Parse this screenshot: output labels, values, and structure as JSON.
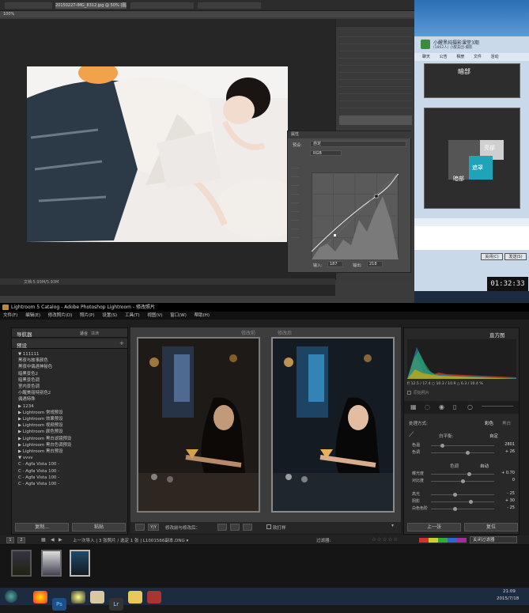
{
  "ps": {
    "tab1": "20150227-IMG_8312.jpg @ 50% (图层 1, RGB/8)",
    "zoom": "50%",
    "zoom_value": "100%",
    "status": "文档:5.93M/5.93M"
  },
  "curves": {
    "panel_tab": "属性",
    "preset": "自定",
    "channel": "RGB",
    "input_label": "输入:",
    "input_value": "187",
    "output_label": "输出:",
    "output_value": "218"
  },
  "chat": {
    "group_title": "小醒黑纯摄影课堂3期",
    "group_sub": "(1862人) 小醒美团-摄影",
    "tabs": [
      "聊天",
      "公告",
      "相册",
      "文件",
      "活动",
      "设置"
    ],
    "panel_labels": [
      "亮部",
      "遮罩",
      "暗部"
    ],
    "btn_close": "关闭(C)",
    "btn_send": "发送(S)",
    "time": "01:32:33"
  },
  "lr": {
    "title": "Lightroom 5 Catalog - Adobe Photoshop Lightroom - 修改照片",
    "menus": [
      "文件(F)",
      "编辑(E)",
      "修改照片(D)",
      "照片(P)",
      "设置(S)",
      "工具(T)",
      "视图(V)",
      "窗口(W)",
      "帮助(H)"
    ],
    "navigator": "导航器",
    "nav_fit": "适合",
    "nav_fill": "填满",
    "presets_title": "预设",
    "preset_tree": [
      "▼ 111111",
      "    黑夜与故事颜色",
      "    黑夜中偶遇神秘色",
      "    暗黑景色2",
      "    暗黑景色调",
      "    室内景色调",
      "    小醒美丽特别色2",
      "    偶遇特殊",
      "▶ 1234",
      "▶ Lightroom 常规预设",
      "▶ Lightroom 效果预设",
      "▶ Lightroom 视频预设",
      "▶ Lightroom 颜色预设",
      "▶ Lightroom 黑白滤镜预设",
      "▶ Lightroom 黑白色调预设",
      "▶ Lightroom 黑白预设",
      "▼ vvvv",
      "    C - Agfa Vista 100 -",
      "    C - Agfa Vista 100 -",
      "    C - Agfa Vista 100 -",
      "    C - Agfa Vista 100 -"
    ],
    "btn_copy": "复制...",
    "btn_paste": "粘贴",
    "before_label": "修改前",
    "after_label": "修改后",
    "toolbar_text": "修改前与修改后：",
    "soft_proof": "软打样",
    "histogram_title": "直方图",
    "hist_info": "f/ 12.5 / 17.4   ○ 10.3 / 10.9   △ 6.3 / 10.4 %",
    "original_photo": "原始照片",
    "treatment_label": "处理方式:",
    "treatment_color": "彩色",
    "treatment_bw": "黑白",
    "wb_label": "白平衡:",
    "wb_value": "自定",
    "sliders_wb": [
      {
        "name": "色温",
        "value": "2801",
        "pos": 0.18
      },
      {
        "name": "色调",
        "value": "+ 26",
        "pos": 0.58
      }
    ],
    "tone_label": "色调",
    "tone_auto": "自动",
    "sliders_tone": [
      {
        "name": "曝光度",
        "value": "+ 0.70",
        "pos": 0.6
      },
      {
        "name": "对比度",
        "value": "0",
        "pos": 0.5
      }
    ],
    "sliders_presence": [
      {
        "name": "高光",
        "value": "- 25",
        "pos": 0.38
      },
      {
        "name": "阴影",
        "value": "+ 30",
        "pos": 0.63
      },
      {
        "name": "白色色阶",
        "value": "- 25",
        "pos": 0.38
      }
    ],
    "btn_prev": "上一张",
    "btn_reset": "复位",
    "film_source": "上一次导入  |  3 张照片 / 选定 1 张  |  L1001566副本.DNG ▾",
    "filter_label": "过滤器:",
    "filter_value": "关闭过滤器",
    "page_1": "1",
    "page_2": "2"
  },
  "taskbar": {
    "clock": "21:09",
    "date": "2015/7/18"
  },
  "colors": {
    "ps_bg": "#3b3b3b",
    "lr_panel": "#282828",
    "taskbar": "#1c2b3f"
  }
}
